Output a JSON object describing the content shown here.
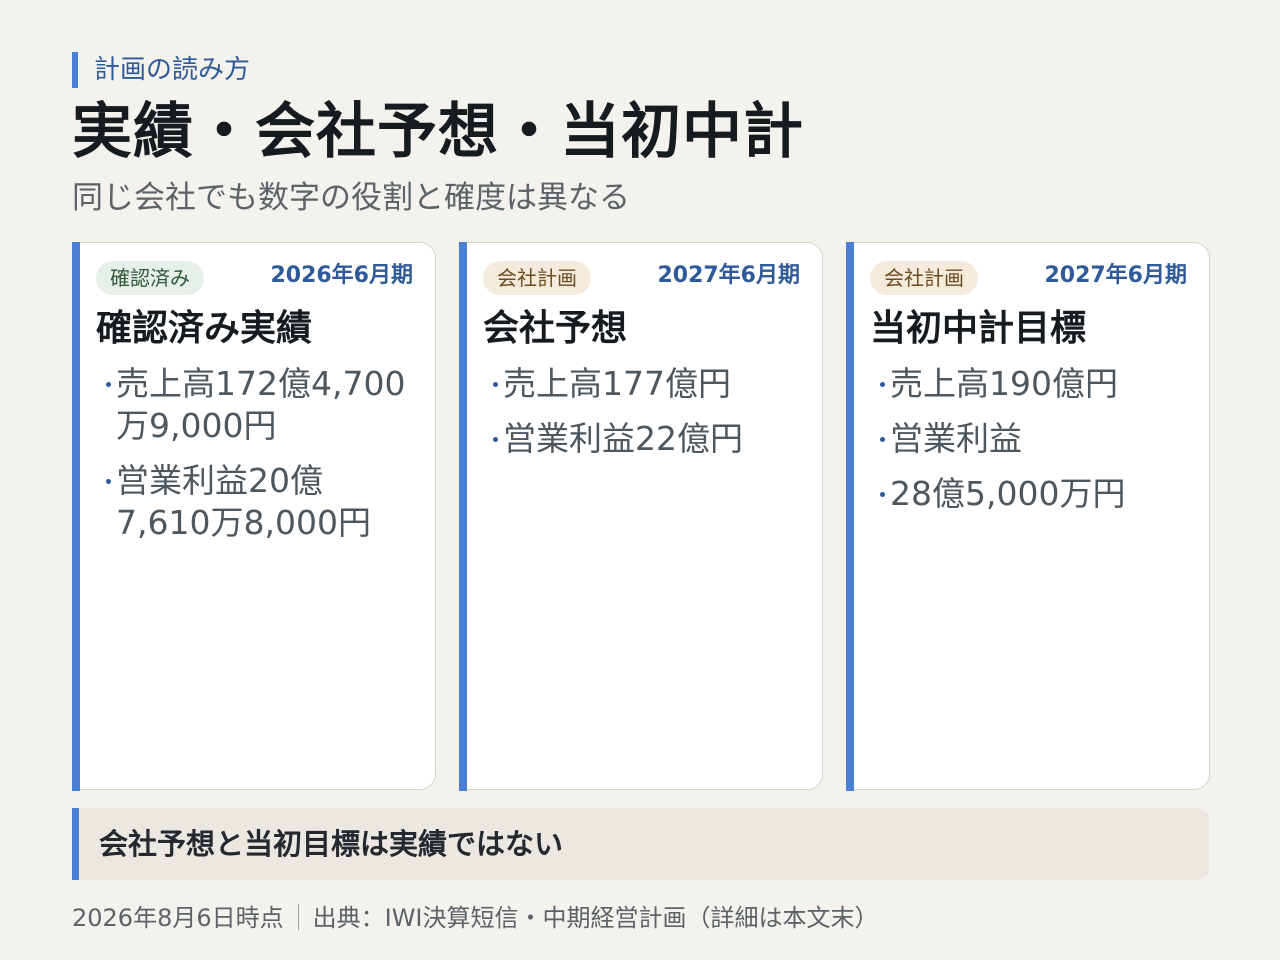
{
  "header": {
    "kicker": "計画の読み方",
    "title": "実績・会社予想・当初中計",
    "subtitle": "同じ会社でも数字の役割と確度は異なる"
  },
  "cards": [
    {
      "badge": "確認済み",
      "period": "2026年6月期",
      "title": "確認済み実績",
      "items": [
        "売上高172億4,700万9,000円",
        "営業利益20億7,610万8,000円"
      ]
    },
    {
      "badge": "会社計画",
      "period": "2027年6月期",
      "title": "会社予想",
      "items": [
        "売上高177億円",
        "営業利益22億円"
      ]
    },
    {
      "badge": "会社計画",
      "period": "2027年6月期",
      "title": "当初中計目標",
      "items": [
        "売上高190億円",
        "営業利益",
        "28億5,000万円"
      ]
    }
  ],
  "note": "会社予想と当初目標は実績ではない",
  "footer": {
    "date": "2026年8月6日時点",
    "source": "出典：IWI決算短信・中期経営計画（詳細は本文末）"
  },
  "colors": {
    "accent": "#4a7fd4",
    "period_text": "#2f5a99",
    "background": "#f4f2ec"
  }
}
